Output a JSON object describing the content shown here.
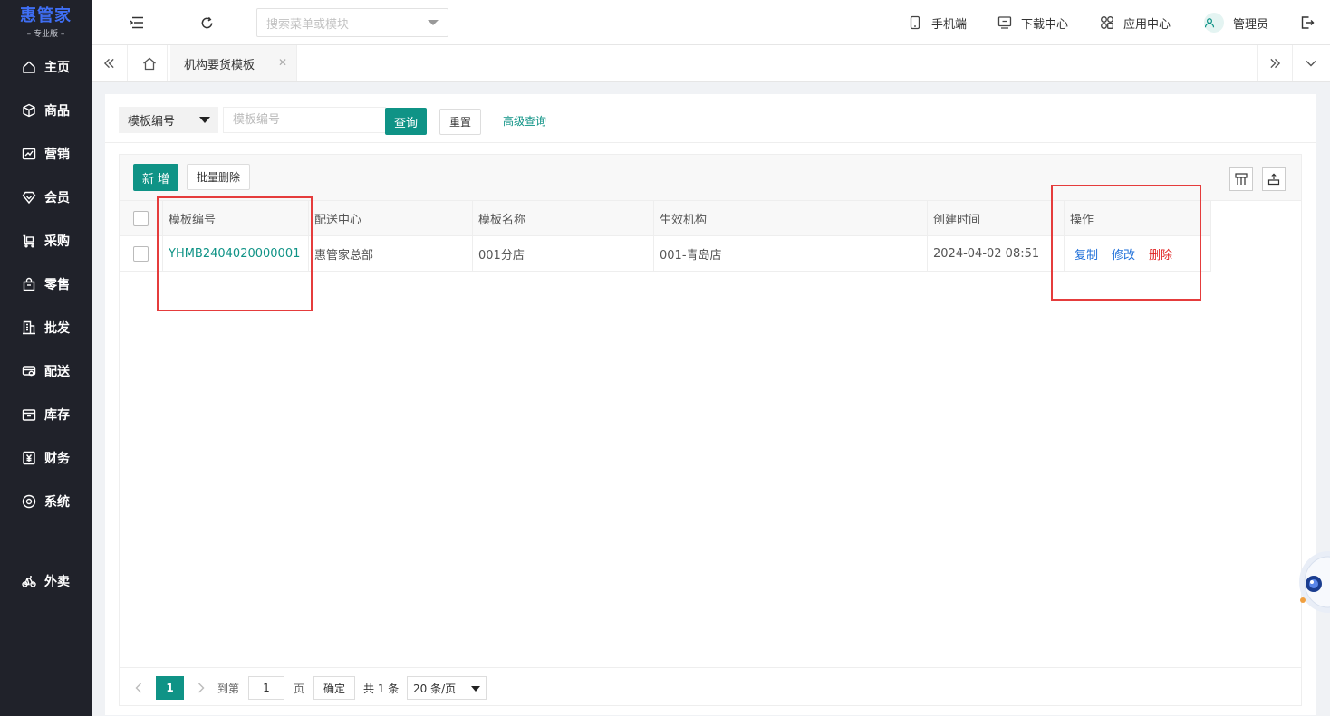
{
  "sidebar": {
    "logo_title": "惠管家",
    "logo_sub": "– 专业版 –",
    "items": [
      {
        "label": "主页",
        "icon": "home-icon"
      },
      {
        "label": "商品",
        "icon": "cube-icon"
      },
      {
        "label": "营销",
        "icon": "chart-icon"
      },
      {
        "label": "会员",
        "icon": "heart-diamond-icon"
      },
      {
        "label": "采购",
        "icon": "cart-icon"
      },
      {
        "label": "零售",
        "icon": "bag-icon"
      },
      {
        "label": "批发",
        "icon": "building-icon"
      },
      {
        "label": "配送",
        "icon": "truck-icon"
      },
      {
        "label": "库存",
        "icon": "box-icon"
      },
      {
        "label": "财务",
        "icon": "yen-icon"
      },
      {
        "label": "系统",
        "icon": "settings-icon"
      },
      {
        "label": "外卖",
        "icon": "bike-icon"
      }
    ]
  },
  "header": {
    "search_placeholder": "搜索菜单或模块",
    "mobile": "手机端",
    "download": "下载中心",
    "apps": "应用中心",
    "user": "管理员"
  },
  "tabs": {
    "active": "机构要货模板"
  },
  "filter": {
    "field_select": "模板编号",
    "input_placeholder": "模板编号",
    "query": "查询",
    "reset": "重置",
    "advanced": "高级查询"
  },
  "toolbar": {
    "add": "新 增",
    "batch_delete": "批量删除"
  },
  "table": {
    "headers": [
      "模板编号",
      "配送中心",
      "模板名称",
      "生效机构",
      "创建时间",
      "操作"
    ],
    "rows": [
      {
        "code": "YHMB2404020000001",
        "center": "惠管家总部",
        "name": "001分店",
        "org": "001-青岛店",
        "created": "2024-04-02 08:51",
        "ops": [
          "复制",
          "修改",
          "删除"
        ]
      }
    ]
  },
  "pager": {
    "current": "1",
    "goto_label": "到第",
    "goto_value": "1",
    "page_label": "页",
    "confirm": "确定",
    "total": "共 1 条",
    "size": "20 条/页"
  },
  "colors": {
    "primary": "#0f9386",
    "sidebar_bg": "#20222a",
    "logo": "#3f6ff5",
    "highlight": "#e53c3c",
    "link_blue": "#1e6fd9",
    "danger": "#e02020"
  }
}
